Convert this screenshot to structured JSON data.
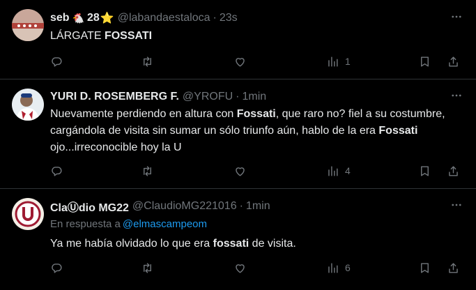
{
  "tweets": [
    {
      "name": "seb",
      "name_emoji": "🐔",
      "count": "28",
      "badge": "⭐",
      "handle": "@labandaestaloca",
      "time": "23s",
      "text_parts": [
        {
          "t": "LÁRGATE ",
          "b": false
        },
        {
          "t": "FOSSATI",
          "b": true
        }
      ],
      "views": "1"
    },
    {
      "name": "YURI D. ROSEMBERG F.",
      "handle": "@YROFU",
      "time": "1min",
      "text_parts": [
        {
          "t": "Nuevamente perdiendo en altura con ",
          "b": false
        },
        {
          "t": "Fossati",
          "b": true
        },
        {
          "t": ", que raro no? fiel a su costumbre, cargándola de visita sin sumar un sólo triunfo aún, hablo de la era ",
          "b": false
        },
        {
          "t": "Fossati",
          "b": true
        },
        {
          "t": " ojo...irreconocible hoy la U",
          "b": false
        }
      ],
      "views": "4"
    },
    {
      "name": "ClaⓊdio MG22",
      "handle": "@ClaudioMG221016",
      "time": "1min",
      "reply_prefix": "En respuesta a",
      "reply_to": "@elmascampeom",
      "text_parts": [
        {
          "t": "Ya me había olvidado lo que era ",
          "b": false
        },
        {
          "t": "fossati",
          "b": true
        },
        {
          "t": " de visita.",
          "b": false
        }
      ],
      "views": "6"
    }
  ],
  "separator": "·",
  "colors": {
    "background": "#000000",
    "text": "#e7e9ea",
    "muted": "#71767b",
    "link": "#1d9bf0",
    "divider": "#2f3336",
    "star": "#f5b400"
  },
  "icons": [
    "reply-icon",
    "retweet-icon",
    "like-icon",
    "views-icon",
    "bookmark-icon",
    "share-icon",
    "more-icon"
  ]
}
